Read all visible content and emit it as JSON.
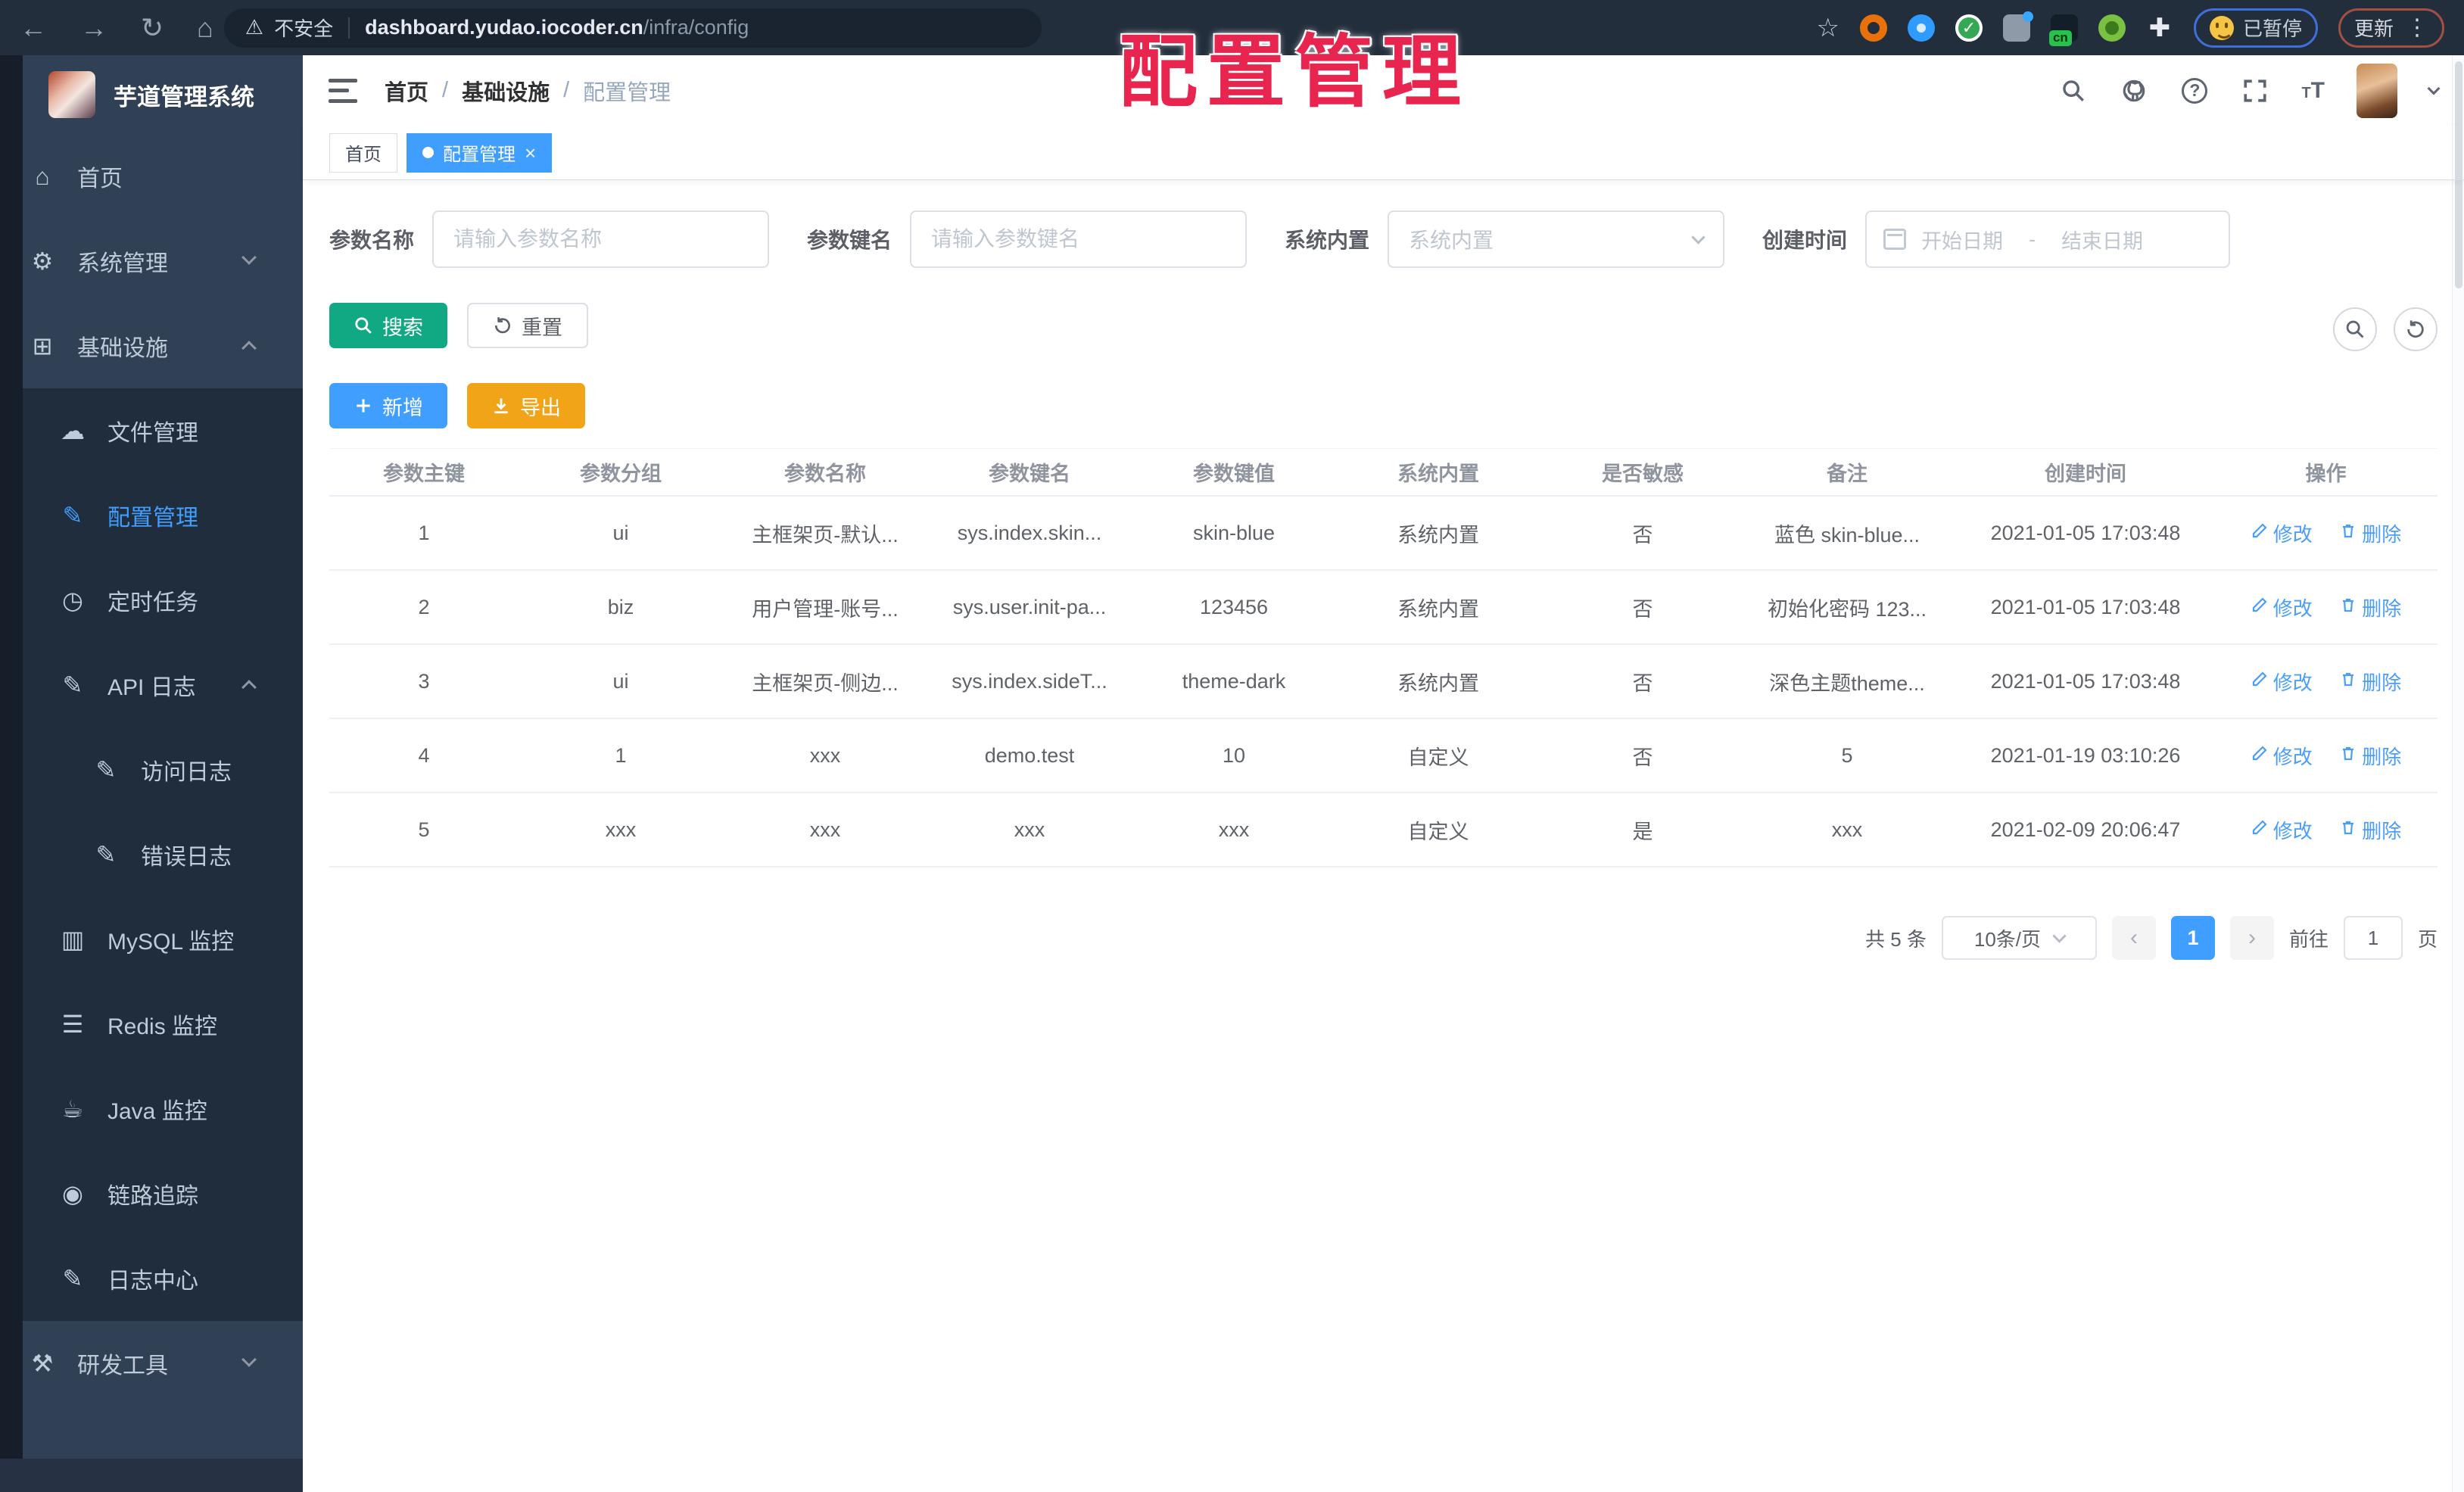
{
  "browser": {
    "security": "不安全",
    "url_domain": "dashboard.yudao.iocoder.cn",
    "url_path": "/infra/config",
    "extension_badge": "cn",
    "extension_check": "✓",
    "paused_label": "已暂停",
    "update_label": "更新"
  },
  "overlay": {
    "title": "配置管理"
  },
  "sidebar": {
    "app_title": "芋道管理系统",
    "menu": [
      {
        "label": "首页",
        "icon": "home-icon",
        "level": 1
      },
      {
        "label": "系统管理",
        "icon": "gear-icon",
        "level": 1,
        "chevron": "down"
      },
      {
        "label": "基础设施",
        "icon": "infra-icon",
        "level": 1,
        "chevron": "up"
      },
      {
        "label": "文件管理",
        "icon": "cloud-upload-icon",
        "level": 2,
        "group": "sub"
      },
      {
        "label": "配置管理",
        "icon": "edit-icon",
        "level": 2,
        "group": "sub",
        "active": true
      },
      {
        "label": "定时任务",
        "icon": "timer-icon",
        "level": 2,
        "group": "sub"
      },
      {
        "label": "API 日志",
        "icon": "log-icon",
        "level": 2,
        "group": "sub",
        "chevron": "up"
      },
      {
        "label": "访问日志",
        "icon": "log-icon",
        "level": 3,
        "group": "sub"
      },
      {
        "label": "错误日志",
        "icon": "log-icon",
        "level": 3,
        "group": "sub"
      },
      {
        "label": "MySQL 监控",
        "icon": "mysql-icon",
        "level": 2,
        "group": "sub"
      },
      {
        "label": "Redis 监控",
        "icon": "redis-icon",
        "level": 2,
        "group": "sub"
      },
      {
        "label": "Java 监控",
        "icon": "java-icon",
        "level": 2,
        "group": "sub"
      },
      {
        "label": "链路追踪",
        "icon": "trace-icon",
        "level": 2,
        "group": "sub"
      },
      {
        "label": "日志中心",
        "icon": "log-icon",
        "level": 2,
        "group": "sub"
      },
      {
        "label": "研发工具",
        "icon": "tools-icon",
        "level": 1,
        "chevron": "down"
      }
    ]
  },
  "header": {
    "breadcrumb": [
      "首页",
      "基础设施",
      "配置管理"
    ],
    "separator": "/"
  },
  "tabs": [
    {
      "label": "首页",
      "active": false,
      "closable": false
    },
    {
      "label": "配置管理",
      "active": true,
      "closable": true
    }
  ],
  "filters": {
    "name_label": "参数名称",
    "name_placeholder": "请输入参数名称",
    "key_label": "参数键名",
    "key_placeholder": "请输入参数键名",
    "type_label": "系统内置",
    "type_placeholder": "系统内置",
    "date_label": "创建时间",
    "date_start": "开始日期",
    "date_separator": "-",
    "date_end": "结束日期",
    "search_label": "搜索",
    "reset_label": "重置",
    "add_label": "新增",
    "export_label": "导出"
  },
  "table": {
    "columns": [
      "参数主键",
      "参数分组",
      "参数名称",
      "参数键名",
      "参数键值",
      "系统内置",
      "是否敏感",
      "备注",
      "创建时间",
      "操作"
    ],
    "rows": [
      {
        "id": "1",
        "group": "ui",
        "name": "主框架页-默认...",
        "key": "sys.index.skin...",
        "value": "skin-blue",
        "type": "系统内置",
        "sensitive": "否",
        "remark": "蓝色 skin-blue...",
        "created": "2021-01-05 17:03:48"
      },
      {
        "id": "2",
        "group": "biz",
        "name": "用户管理-账号...",
        "key": "sys.user.init-pa...",
        "value": "123456",
        "type": "系统内置",
        "sensitive": "否",
        "remark": "初始化密码 123...",
        "created": "2021-01-05 17:03:48"
      },
      {
        "id": "3",
        "group": "ui",
        "name": "主框架页-侧边...",
        "key": "sys.index.sideT...",
        "value": "theme-dark",
        "type": "系统内置",
        "sensitive": "否",
        "remark": "深色主题theme...",
        "created": "2021-01-05 17:03:48"
      },
      {
        "id": "4",
        "group": "1",
        "name": "xxx",
        "key": "demo.test",
        "value": "10",
        "type": "自定义",
        "sensitive": "否",
        "remark": "5",
        "created": "2021-01-19 03:10:26"
      },
      {
        "id": "5",
        "group": "xxx",
        "name": "xxx",
        "key": "xxx",
        "value": "xxx",
        "type": "自定义",
        "sensitive": "是",
        "remark": "xxx",
        "created": "2021-02-09 20:06:47"
      }
    ],
    "edit_label": "修改",
    "delete_label": "删除"
  },
  "pagination": {
    "total_text": "共 5 条",
    "page_size": "10条/页",
    "prev": "‹",
    "next": "›",
    "current_page": "1",
    "goto_label": "前往",
    "goto_value": "1",
    "unit_label": "页"
  },
  "colors": {
    "accent": "#409eff",
    "search_button": "#11a983",
    "export_button": "#f1a417",
    "annotation_red": "#e8254e",
    "sidebar_bg": "#304156",
    "submenu_bg": "#1f2d3d"
  }
}
